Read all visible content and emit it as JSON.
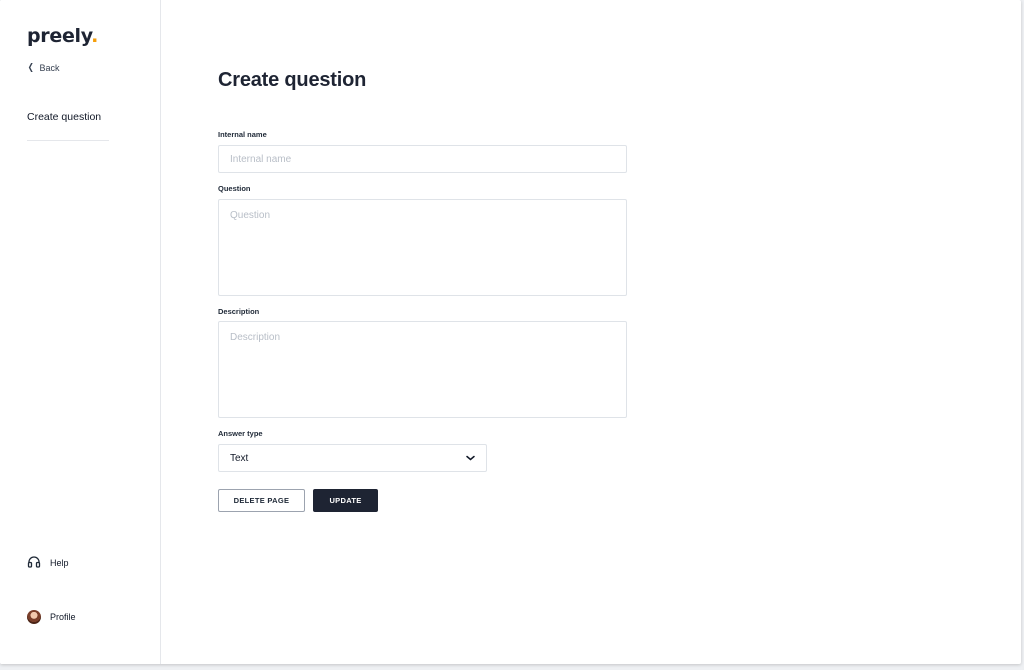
{
  "brand": {
    "name": "preely",
    "dot": ".",
    "accent_color": "#f59e0b"
  },
  "sidebar": {
    "back_label": "Back",
    "back_icon": "chevron-left-icon",
    "items": [
      {
        "label": "Create question"
      }
    ],
    "help_label": "Help",
    "help_icon": "headset-icon",
    "profile_label": "Profile"
  },
  "main": {
    "title": "Create question",
    "fields": {
      "internal_name": {
        "label": "Internal name",
        "placeholder": "Internal name",
        "value": ""
      },
      "question": {
        "label": "Question",
        "placeholder": "Question",
        "value": ""
      },
      "description": {
        "label": "Description",
        "placeholder": "Description",
        "value": ""
      },
      "answer_type": {
        "label": "Answer type",
        "value": "Text"
      }
    },
    "buttons": {
      "delete": "DELETE PAGE",
      "update": "UPDATE"
    }
  },
  "colors": {
    "primary": "#1e2433",
    "border": "#dfe3e8"
  }
}
